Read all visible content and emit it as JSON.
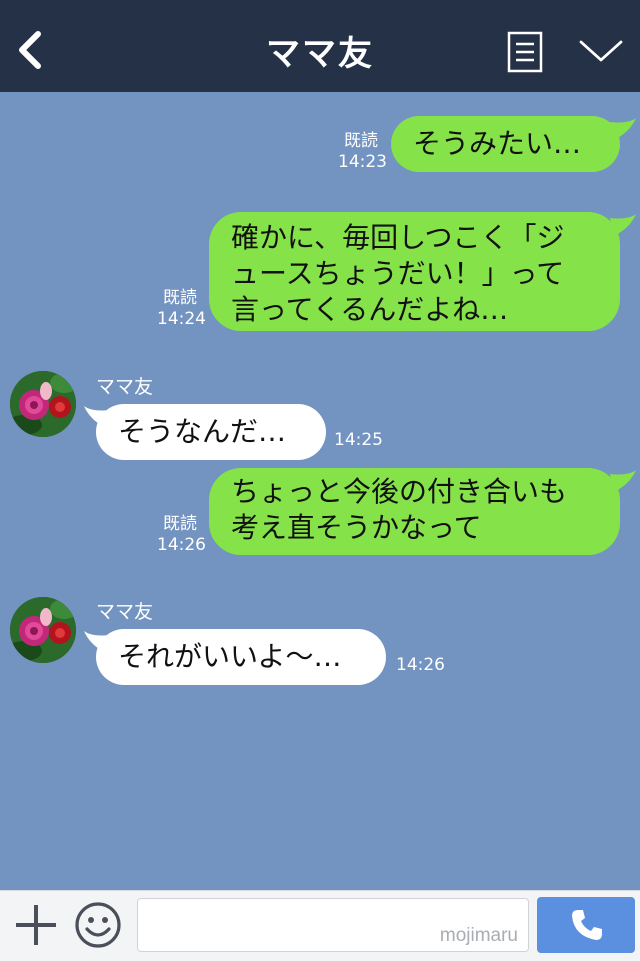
{
  "header": {
    "title": "ママ友",
    "icons": [
      "back-chevron-icon",
      "notes-icon",
      "chevron-down-icon"
    ]
  },
  "messages": [
    {
      "side": "me",
      "lines": [
        "そうみたい…"
      ],
      "read": "既読",
      "time": "14:23"
    },
    {
      "side": "me",
      "lines": [
        "確かに、毎回しつこく「ジ",
        "ュースちょうだい！」って",
        "言ってくるんだよね…"
      ],
      "read": "既読",
      "time": "14:24"
    },
    {
      "side": "them",
      "sender": "ママ友",
      "lines": [
        "そうなんだ…"
      ],
      "time": "14:25"
    },
    {
      "side": "me",
      "lines": [
        "ちょっと今後の付き合いも",
        "考え直そうかなって"
      ],
      "read": "既読",
      "time": "14:26"
    },
    {
      "side": "them",
      "sender": "ママ友",
      "lines": [
        "それがいいよ〜…"
      ],
      "time": "14:26"
    }
  ],
  "inputbar": {
    "placeholder": "",
    "watermark": "mojimaru",
    "icons": [
      "plus-icon",
      "emoji-icon",
      "phone-icon"
    ]
  },
  "colors": {
    "header_bg": "#243147",
    "chat_bg": "#7393c1",
    "my_bubble": "#85e249",
    "their_bubble": "#ffffff",
    "call_button": "#5b8fe0"
  }
}
